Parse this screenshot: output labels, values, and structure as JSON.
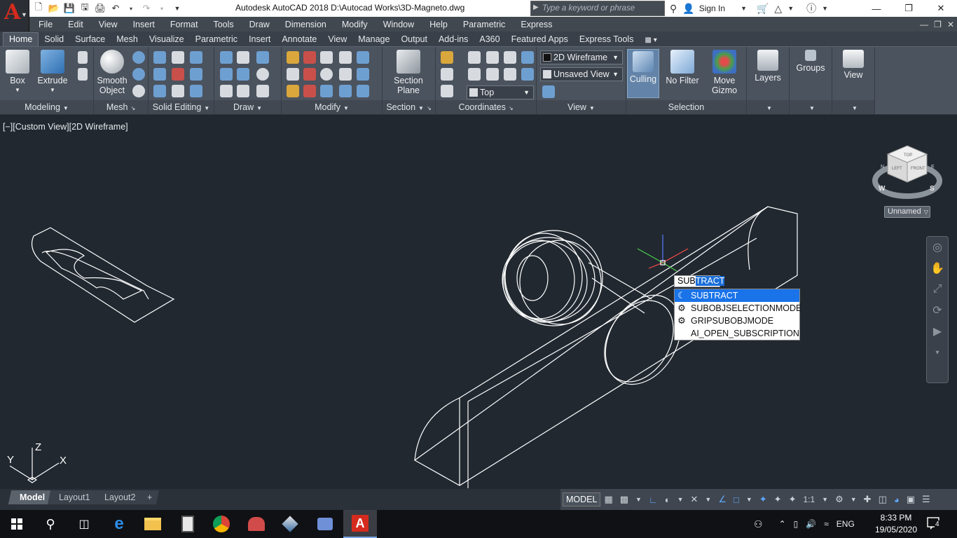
{
  "app": {
    "title": "Autodesk AutoCAD 2018    D:\\Autocad Works\\3D-Magneto.dwg",
    "logo_letter": "A",
    "search_placeholder": "Type a keyword or phrase",
    "sign_in": "Sign In"
  },
  "menu": [
    "File",
    "Edit",
    "View",
    "Insert",
    "Format",
    "Tools",
    "Draw",
    "Dimension",
    "Modify",
    "Window",
    "Help",
    "Parametric",
    "Express"
  ],
  "ribbon_tabs": [
    "Home",
    "Solid",
    "Surface",
    "Mesh",
    "Visualize",
    "Parametric",
    "Insert",
    "Annotate",
    "View",
    "Manage",
    "Output",
    "Add-ins",
    "A360",
    "Featured Apps",
    "Express Tools"
  ],
  "ribbon": {
    "box": "Box",
    "extrude": "Extrude",
    "smooth_object": "Smooth Object",
    "section_plane": "Section Plane",
    "culling": "Culling",
    "no_filter": "No Filter",
    "move_gizmo": "Move Gizmo",
    "layers": "Layers",
    "groups": "Groups",
    "view_btn": "View",
    "visual_style": "2D Wireframe",
    "named_view": "Unsaved View",
    "ucs_view": "Top",
    "panels": {
      "modeling": "Modeling",
      "mesh": "Mesh",
      "solid_editing": "Solid Editing",
      "draw": "Draw",
      "modify": "Modify",
      "section": "Section",
      "coordinates": "Coordinates",
      "view": "View",
      "selection": "Selection"
    }
  },
  "viewport": {
    "label": "[−][Custom View][2D Wireframe]",
    "ucs_name": "Unnamed",
    "cube": {
      "top": "TOP",
      "left": "LEFT",
      "front": "FRONT",
      "w": "W",
      "s": "S",
      "n": "N",
      "e": "E"
    },
    "axes": {
      "x": "X",
      "y": "Y",
      "z": "Z"
    }
  },
  "command": {
    "typed": "SUB",
    "completion": "TRACT",
    "suggestions": [
      "SUBTRACT",
      "SUBOBJSELECTIONMODE",
      "GRIPSUBOBJMODE",
      "AI_OPEN_SUBSCRIPTION"
    ]
  },
  "layout_tabs": [
    "Model",
    "Layout1",
    "Layout2"
  ],
  "layout_add": "+",
  "status": {
    "model": "MODEL",
    "scale": "1:1"
  },
  "tray": {
    "lang": "ENG",
    "time": "8:33 PM",
    "date": "19/05/2020",
    "notif_count": "4"
  }
}
